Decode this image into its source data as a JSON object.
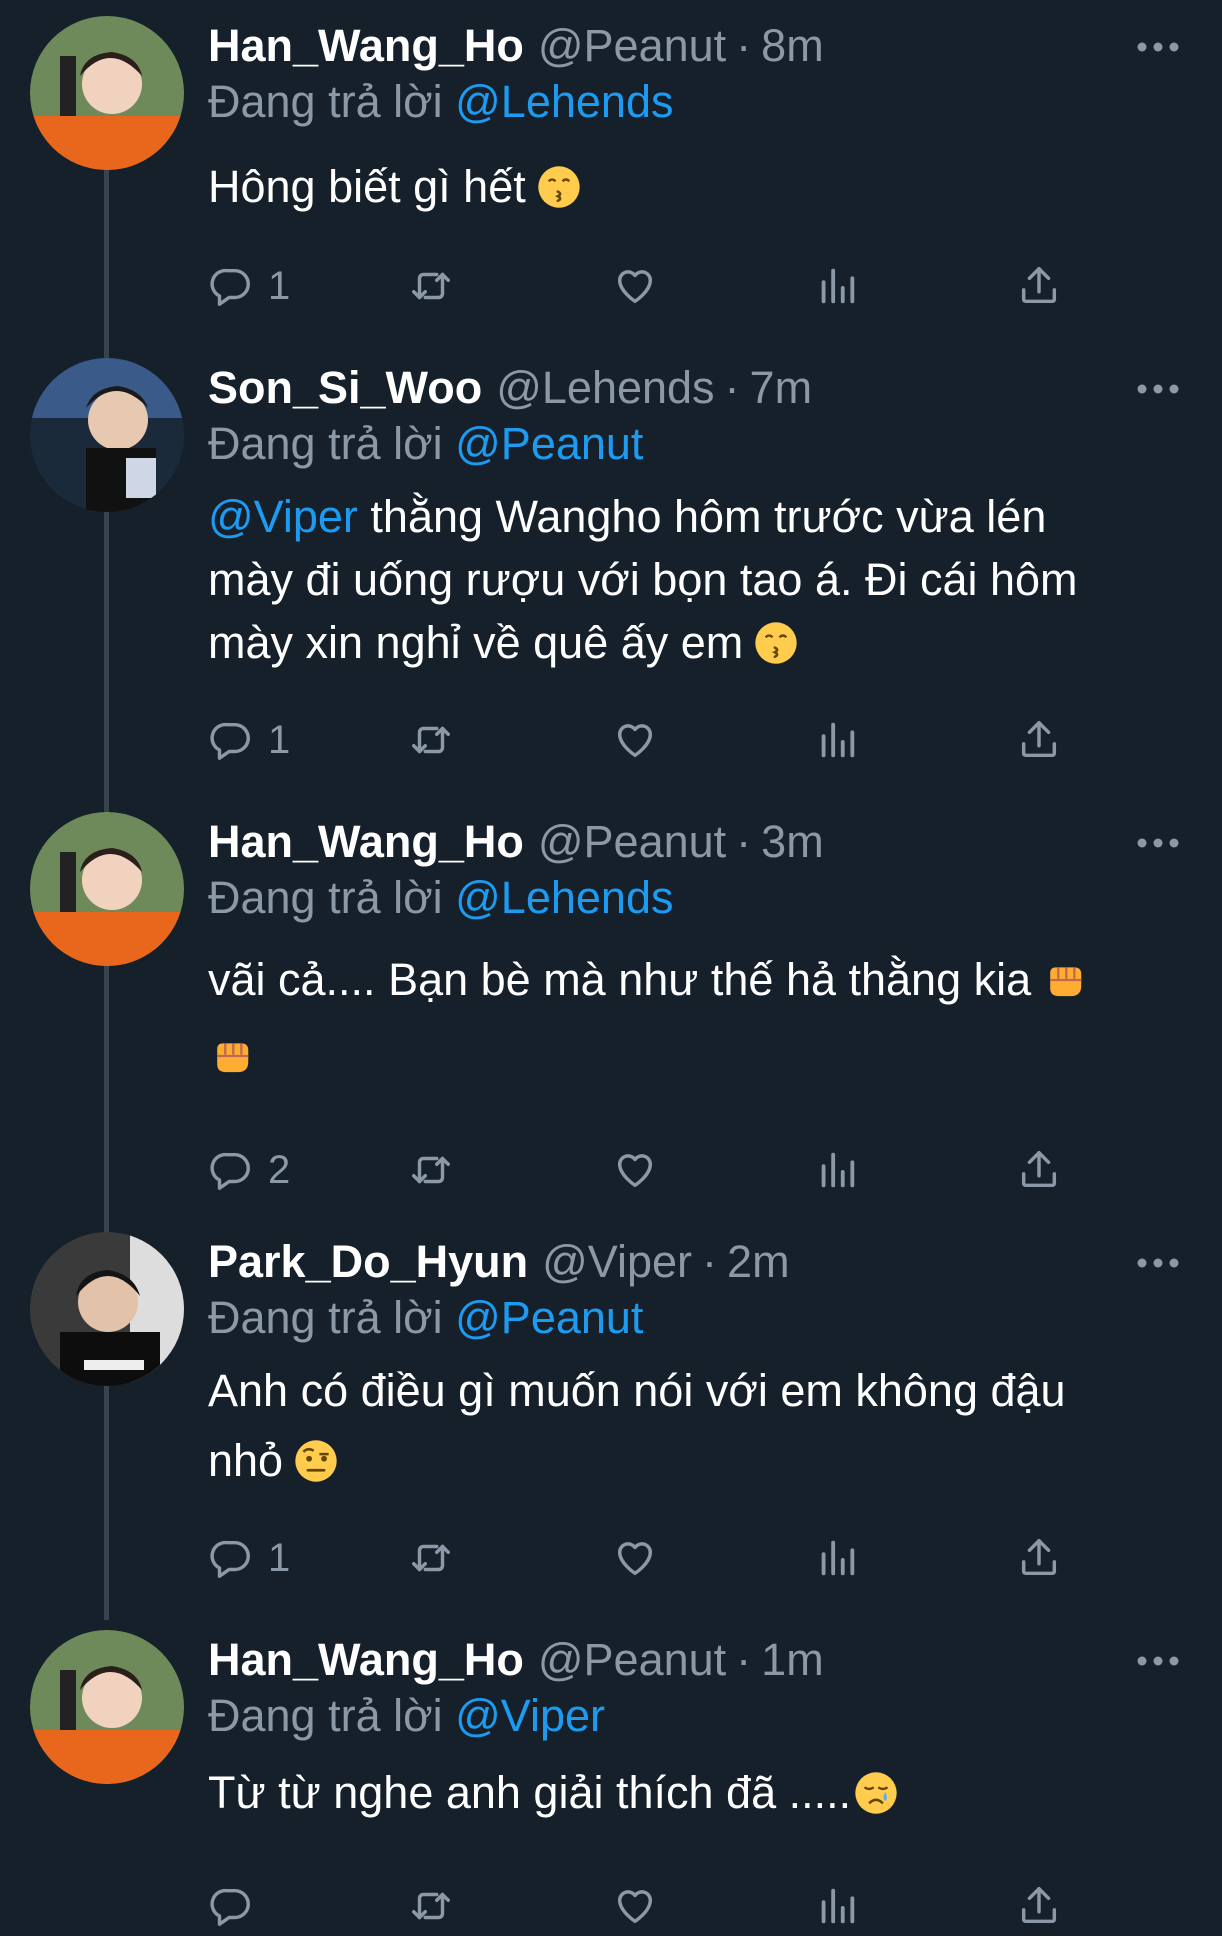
{
  "tweets": [
    {
      "name": "Han_Wang_Ho",
      "handle": "@Peanut",
      "dot": "·",
      "time": "8m",
      "reply_label": "Đang trả lời",
      "reply_to": "@Lehends",
      "text": "Hông biết gì hết",
      "emojis": [
        "kissing-face-emoji"
      ],
      "reply_count": "1"
    },
    {
      "name": "Son_Si_Woo",
      "handle": "@Lehends",
      "dot": "·",
      "time": "7m",
      "reply_label": "Đang trả lời",
      "reply_to": "@Peanut",
      "mention": "@Viper",
      "text_line1": " thằng Wangho hôm trước vừa lén",
      "text_line2": "mày đi uống rượu với bọn tao á. Đi cái hôm",
      "text_line3": "mày xin nghỉ về quê ấy em",
      "emojis": [
        "kissing-face-emoji"
      ],
      "reply_count": "1"
    },
    {
      "name": "Han_Wang_Ho",
      "handle": "@Peanut",
      "dot": "·",
      "time": "3m",
      "reply_label": "Đang trả lời",
      "reply_to": "@Lehends",
      "text": "vãi cả.... Bạn bè mà như thế hả thằng kia",
      "emojis": [
        "oncoming-fist-emoji",
        "oncoming-fist-emoji"
      ],
      "reply_count": "2"
    },
    {
      "name": "Park_Do_Hyun",
      "handle": "@Viper",
      "dot": "·",
      "time": "2m",
      "reply_label": "Đang trả lời",
      "reply_to": "@Peanut",
      "text_line1": "Anh có điều gì muốn nói với em không đậu",
      "text_line2": "nhỏ",
      "emojis": [
        "face-with-raised-eyebrow-emoji"
      ],
      "reply_count": "1"
    },
    {
      "name": "Han_Wang_Ho",
      "handle": "@Peanut",
      "dot": "·",
      "time": "1m",
      "reply_label": "Đang trả lời",
      "reply_to": "@Viper",
      "text": "Từ từ nghe anh giải thích đã .....",
      "emojis": [
        "crying-face-emoji"
      ],
      "reply_count": ""
    }
  ],
  "icons": {
    "reply": "reply-icon",
    "retweet": "retweet-icon",
    "like": "heart-icon",
    "views": "views-icon",
    "share": "share-icon",
    "more": "more-icon"
  },
  "colors": {
    "background": "#15202b",
    "link": "#1d9bf0",
    "muted": "#8b98a5",
    "thread_line": "#38444d"
  }
}
